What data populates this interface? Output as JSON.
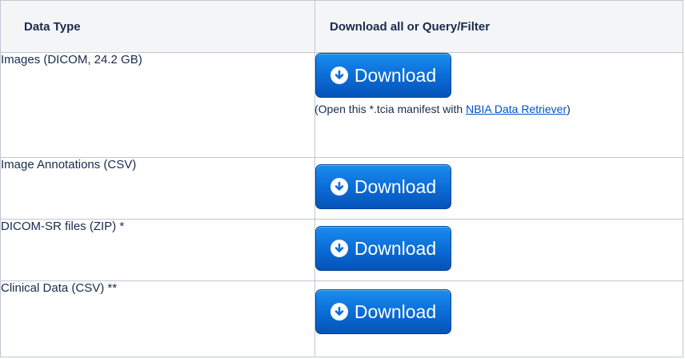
{
  "table": {
    "headers": {
      "data_type": "Data Type",
      "download": "Download all or Query/Filter"
    },
    "rows": [
      {
        "label": "Images (DICOM, 24.2 GB)",
        "button": "Download",
        "note_prefix": "(Open this *.tcia manifest with ",
        "note_link": "NBIA Data Retriever",
        "note_suffix": ")"
      },
      {
        "label": "Image Annotations (CSV)",
        "button": "Download"
      },
      {
        "label": "DICOM-SR files (ZIP) *",
        "button": "Download"
      },
      {
        "label": "Clinical Data (CSV) **",
        "button": "Download"
      }
    ]
  },
  "colors": {
    "button": "#0b6fd8",
    "link": "#0052cc",
    "header_bg": "#f4f5f7",
    "border": "#c1c7d0"
  },
  "icons": {
    "download": "circle-arrow-down-icon"
  }
}
